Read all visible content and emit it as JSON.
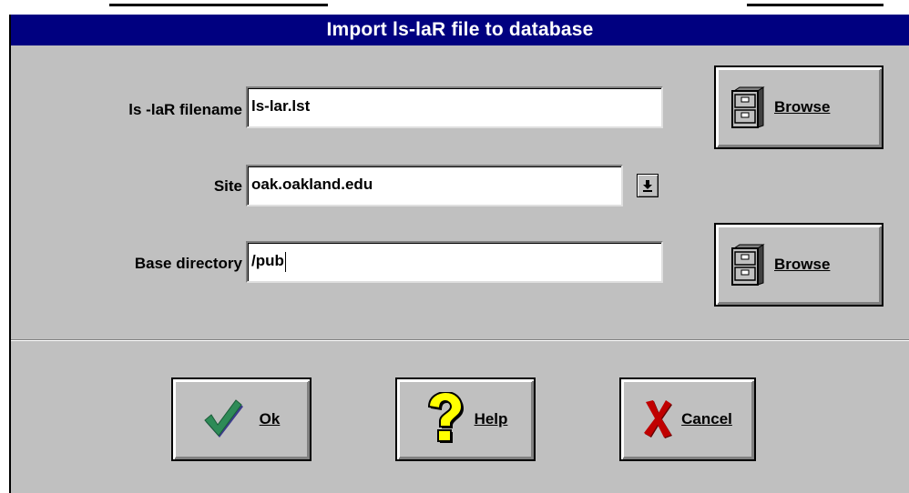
{
  "dialog": {
    "title": "Import ls-laR file to database"
  },
  "form": {
    "filename_label": "ls -laR filename",
    "filename_value": "ls-lar.lst",
    "site_label": "Site",
    "site_value": "oak.oakland.edu",
    "basedir_label": "Base directory",
    "basedir_value": "/pub"
  },
  "buttons": {
    "browse_label": "Browse",
    "ok_label": "Ok",
    "help_label": "Help",
    "cancel_label": "Cancel"
  },
  "colors": {
    "title_bar": "#000080",
    "dialog_face": "#c0c0c0",
    "ok_check": "#2e8b57",
    "cancel_x": "#c00000",
    "help_question": "#ffff00"
  },
  "icons": {
    "browse": "file-cabinet-icon",
    "dropdown": "dropdown-arrow-icon",
    "ok": "checkmark-icon",
    "help": "question-mark-icon",
    "cancel": "x-mark-icon"
  }
}
